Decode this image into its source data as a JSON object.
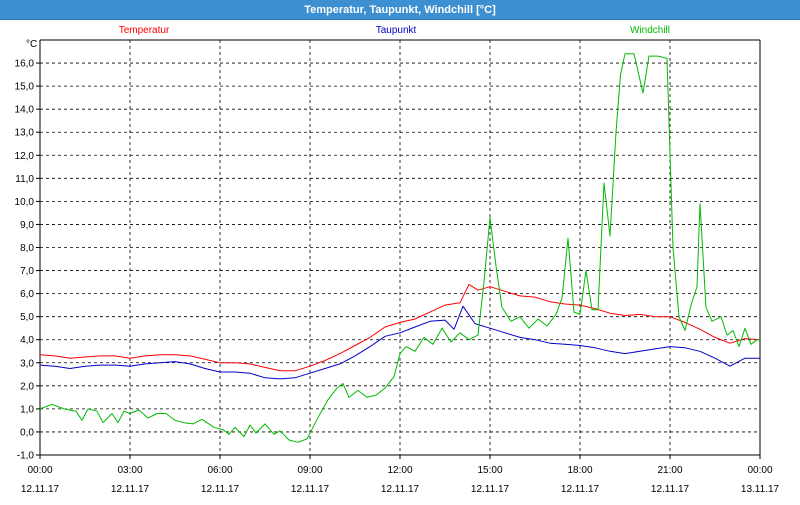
{
  "window": {
    "title": "Temperatur, Taupunkt, Windchill [°C]"
  },
  "chart_data": {
    "type": "line",
    "title": "Temperatur, Taupunkt, Windchill [°C]",
    "ylabel": "°C",
    "ylim": [
      -1.0,
      17.0
    ],
    "yticks": [
      -1.0,
      0.0,
      1.0,
      2.0,
      3.0,
      4.0,
      5.0,
      6.0,
      7.0,
      8.0,
      9.0,
      10.0,
      11.0,
      12.0,
      13.0,
      14.0,
      15.0,
      16.0
    ],
    "ytick_labels": [
      "-1,0",
      "0,0",
      "1,0",
      "2,0",
      "3,0",
      "4,0",
      "5,0",
      "6,0",
      "7,0",
      "8,0",
      "9,0",
      "10,0",
      "11,0",
      "12,0",
      "13,0",
      "14,0",
      "15,0",
      "16,0"
    ],
    "xlim": [
      0,
      24
    ],
    "xticks": [
      0,
      3,
      6,
      9,
      12,
      15,
      18,
      21,
      24
    ],
    "xtick_time_labels": [
      "00:00",
      "03:00",
      "06:00",
      "09:00",
      "12:00",
      "15:00",
      "18:00",
      "21:00",
      "00:00"
    ],
    "xtick_date_labels": [
      "12.11.17",
      "12.11.17",
      "12.11.17",
      "12.11.17",
      "12.11.17",
      "12.11.17",
      "12.11.17",
      "12.11.17",
      "13.11.17"
    ],
    "grid": true,
    "legend_position": "top",
    "series": [
      {
        "name": "Temperatur",
        "color": "#ff0000",
        "points": [
          [
            0,
            3.35
          ],
          [
            0.5,
            3.3
          ],
          [
            1,
            3.2
          ],
          [
            1.5,
            3.25
          ],
          [
            2,
            3.3
          ],
          [
            2.5,
            3.3
          ],
          [
            3,
            3.2
          ],
          [
            3.5,
            3.3
          ],
          [
            4,
            3.35
          ],
          [
            4.5,
            3.35
          ],
          [
            5,
            3.3
          ],
          [
            5.5,
            3.15
          ],
          [
            6,
            3.0
          ],
          [
            6.5,
            3.0
          ],
          [
            7,
            2.95
          ],
          [
            7.5,
            2.8
          ],
          [
            8,
            2.65
          ],
          [
            8.5,
            2.65
          ],
          [
            9,
            2.85
          ],
          [
            9.5,
            3.1
          ],
          [
            10,
            3.4
          ],
          [
            10.5,
            3.75
          ],
          [
            11,
            4.1
          ],
          [
            11.5,
            4.55
          ],
          [
            12,
            4.75
          ],
          [
            12.5,
            4.9
          ],
          [
            13,
            5.2
          ],
          [
            13.5,
            5.5
          ],
          [
            14,
            5.6
          ],
          [
            14.3,
            6.4
          ],
          [
            14.6,
            6.15
          ],
          [
            15,
            6.3
          ],
          [
            15.5,
            6.1
          ],
          [
            16,
            5.9
          ],
          [
            16.5,
            5.85
          ],
          [
            17,
            5.65
          ],
          [
            17.5,
            5.55
          ],
          [
            18,
            5.5
          ],
          [
            18.5,
            5.35
          ],
          [
            19,
            5.15
          ],
          [
            19.5,
            5.05
          ],
          [
            20,
            5.1
          ],
          [
            20.5,
            5.0
          ],
          [
            21,
            5.0
          ],
          [
            21.5,
            4.75
          ],
          [
            22,
            4.45
          ],
          [
            22.5,
            4.1
          ],
          [
            23,
            3.85
          ],
          [
            23.5,
            4.05
          ],
          [
            24,
            4.0
          ]
        ]
      },
      {
        "name": "Taupunkt",
        "color": "#0000cc",
        "points": [
          [
            0,
            2.9
          ],
          [
            0.5,
            2.85
          ],
          [
            1,
            2.75
          ],
          [
            1.5,
            2.85
          ],
          [
            2,
            2.9
          ],
          [
            2.5,
            2.9
          ],
          [
            3,
            2.85
          ],
          [
            3.5,
            2.95
          ],
          [
            4,
            3.0
          ],
          [
            4.5,
            3.05
          ],
          [
            5,
            2.95
          ],
          [
            5.5,
            2.75
          ],
          [
            6,
            2.6
          ],
          [
            6.5,
            2.6
          ],
          [
            7,
            2.55
          ],
          [
            7.5,
            2.35
          ],
          [
            8,
            2.3
          ],
          [
            8.5,
            2.35
          ],
          [
            9,
            2.55
          ],
          [
            9.5,
            2.75
          ],
          [
            10,
            2.95
          ],
          [
            10.5,
            3.3
          ],
          [
            11,
            3.7
          ],
          [
            11.5,
            4.15
          ],
          [
            12,
            4.3
          ],
          [
            12.5,
            4.55
          ],
          [
            13,
            4.8
          ],
          [
            13.5,
            4.85
          ],
          [
            13.8,
            4.45
          ],
          [
            14.1,
            5.45
          ],
          [
            14.5,
            4.7
          ],
          [
            15,
            4.5
          ],
          [
            15.5,
            4.3
          ],
          [
            16,
            4.1
          ],
          [
            16.5,
            4.0
          ],
          [
            17,
            3.85
          ],
          [
            17.5,
            3.8
          ],
          [
            18,
            3.75
          ],
          [
            18.5,
            3.65
          ],
          [
            19,
            3.5
          ],
          [
            19.5,
            3.4
          ],
          [
            20,
            3.5
          ],
          [
            20.5,
            3.6
          ],
          [
            21,
            3.7
          ],
          [
            21.5,
            3.65
          ],
          [
            22,
            3.5
          ],
          [
            22.5,
            3.2
          ],
          [
            23,
            2.85
          ],
          [
            23.5,
            3.2
          ],
          [
            24,
            3.2
          ]
        ]
      },
      {
        "name": "Windchill",
        "color": "#00bb00",
        "points": [
          [
            0,
            1.0
          ],
          [
            0.4,
            1.2
          ],
          [
            0.8,
            1.0
          ],
          [
            1.2,
            0.9
          ],
          [
            1.4,
            0.5
          ],
          [
            1.6,
            1.0
          ],
          [
            1.9,
            0.9
          ],
          [
            2.1,
            0.4
          ],
          [
            2.4,
            0.8
          ],
          [
            2.6,
            0.4
          ],
          [
            2.8,
            0.9
          ],
          [
            3.0,
            0.8
          ],
          [
            3.3,
            0.95
          ],
          [
            3.6,
            0.6
          ],
          [
            3.9,
            0.8
          ],
          [
            4.2,
            0.8
          ],
          [
            4.5,
            0.5
          ],
          [
            4.8,
            0.4
          ],
          [
            5.1,
            0.35
          ],
          [
            5.4,
            0.55
          ],
          [
            5.8,
            0.2
          ],
          [
            6.1,
            0.1
          ],
          [
            6.3,
            -0.1
          ],
          [
            6.5,
            0.2
          ],
          [
            6.8,
            -0.2
          ],
          [
            7.0,
            0.3
          ],
          [
            7.2,
            -0.05
          ],
          [
            7.5,
            0.35
          ],
          [
            7.8,
            -0.1
          ],
          [
            8.0,
            0.05
          ],
          [
            8.3,
            -0.35
          ],
          [
            8.6,
            -0.45
          ],
          [
            8.9,
            -0.3
          ],
          [
            9.1,
            0.2
          ],
          [
            9.3,
            0.7
          ],
          [
            9.6,
            1.4
          ],
          [
            9.9,
            1.9
          ],
          [
            10.1,
            2.1
          ],
          [
            10.3,
            1.5
          ],
          [
            10.6,
            1.8
          ],
          [
            10.9,
            1.5
          ],
          [
            11.2,
            1.6
          ],
          [
            11.5,
            1.9
          ],
          [
            11.8,
            2.4
          ],
          [
            12.0,
            3.4
          ],
          [
            12.2,
            3.7
          ],
          [
            12.5,
            3.5
          ],
          [
            12.8,
            4.1
          ],
          [
            13.1,
            3.8
          ],
          [
            13.4,
            4.5
          ],
          [
            13.7,
            3.9
          ],
          [
            14.0,
            4.3
          ],
          [
            14.3,
            4.0
          ],
          [
            14.6,
            4.2
          ],
          [
            14.8,
            6.5
          ],
          [
            15.0,
            9.3
          ],
          [
            15.2,
            7.2
          ],
          [
            15.4,
            5.4
          ],
          [
            15.7,
            4.8
          ],
          [
            16.0,
            5.0
          ],
          [
            16.3,
            4.5
          ],
          [
            16.6,
            4.9
          ],
          [
            16.9,
            4.6
          ],
          [
            17.2,
            5.1
          ],
          [
            17.4,
            5.8
          ],
          [
            17.6,
            8.4
          ],
          [
            17.8,
            5.2
          ],
          [
            18.0,
            5.1
          ],
          [
            18.2,
            7.0
          ],
          [
            18.4,
            5.3
          ],
          [
            18.6,
            5.3
          ],
          [
            18.8,
            10.8
          ],
          [
            19.0,
            8.5
          ],
          [
            19.2,
            13.0
          ],
          [
            19.35,
            15.5
          ],
          [
            19.5,
            16.4
          ],
          [
            19.8,
            16.4
          ],
          [
            20.1,
            14.7
          ],
          [
            20.3,
            16.3
          ],
          [
            20.6,
            16.3
          ],
          [
            20.9,
            16.2
          ],
          [
            21.1,
            8.0
          ],
          [
            21.3,
            5.0
          ],
          [
            21.5,
            4.4
          ],
          [
            21.7,
            5.5
          ],
          [
            21.9,
            6.3
          ],
          [
            22.0,
            9.9
          ],
          [
            22.2,
            5.4
          ],
          [
            22.4,
            4.8
          ],
          [
            22.7,
            5.0
          ],
          [
            22.9,
            4.2
          ],
          [
            23.1,
            4.4
          ],
          [
            23.3,
            3.7
          ],
          [
            23.5,
            4.5
          ],
          [
            23.7,
            3.8
          ],
          [
            23.9,
            4.0
          ],
          [
            24,
            4.0
          ]
        ]
      }
    ]
  }
}
